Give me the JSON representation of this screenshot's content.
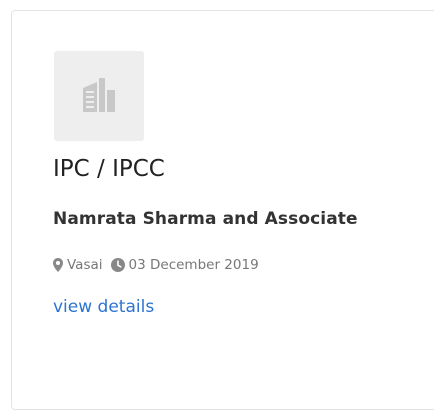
{
  "card": {
    "logo_icon": "building-icon",
    "title": "IPC / IPCC",
    "company": "Namrata Sharma and Associate",
    "location": "Vasai",
    "location_icon": "map-marker-icon",
    "date": "03 December 2019",
    "date_icon": "clock-icon",
    "link_label": "view details",
    "link_color": "#2c73d2"
  }
}
